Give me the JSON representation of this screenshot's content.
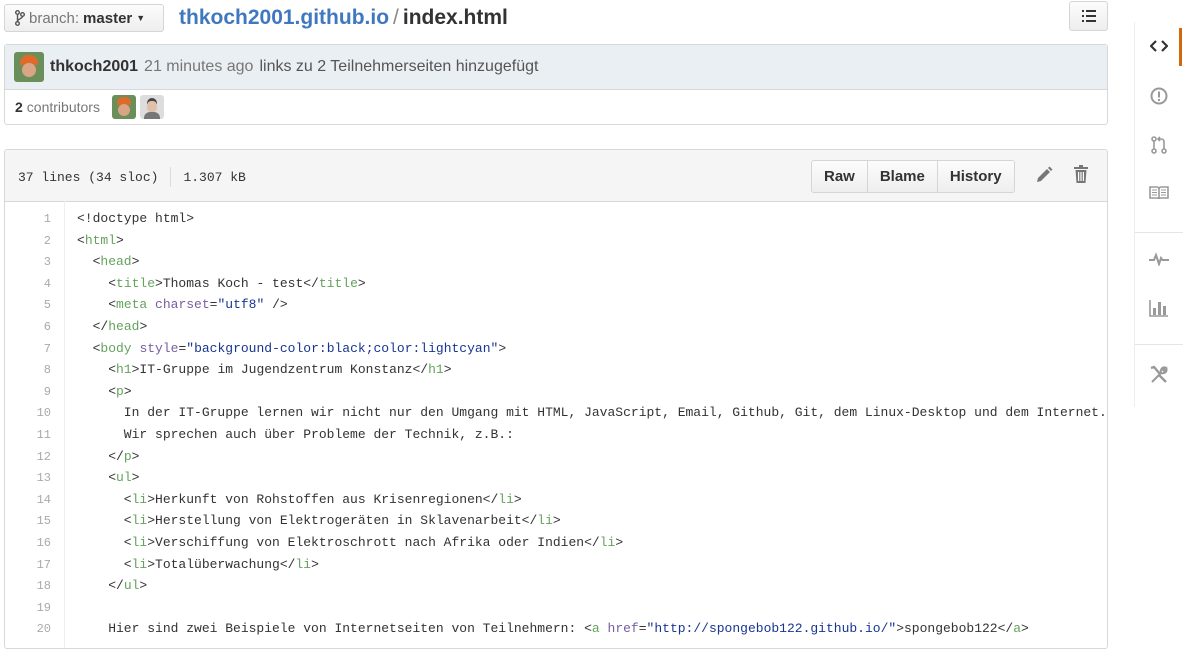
{
  "header": {
    "branch_label": "branch:",
    "branch_value": "master",
    "repo": "thkoch2001.github.io",
    "separator": "/",
    "file": "index.html"
  },
  "commit": {
    "author": "thkoch2001",
    "time": "21 minutes ago",
    "message": "links zu 2 Teilnehmerseiten hinzugefügt",
    "contributors_count": "2",
    "contributors_label": "contributors"
  },
  "file": {
    "lines_info": "37 lines (34 sloc)",
    "size": "1.307 kB",
    "buttons": [
      "Raw",
      "Blame",
      "History"
    ]
  },
  "code": [
    {
      "n": "1",
      "html": "&lt;!doctype html&gt;"
    },
    {
      "n": "2",
      "html": "&lt;<span class=\"t\">html</span>&gt;"
    },
    {
      "n": "3",
      "html": "  &lt;<span class=\"t\">head</span>&gt;"
    },
    {
      "n": "4",
      "html": "    &lt;<span class=\"t\">title</span>&gt;Thomas Koch - test&lt;/<span class=\"t\">title</span>&gt;"
    },
    {
      "n": "5",
      "html": "    &lt;<span class=\"t\">meta</span> <span class=\"a\">charset</span>=<span class=\"s\">\"utf8\"</span> /&gt;"
    },
    {
      "n": "6",
      "html": "  &lt;/<span class=\"t\">head</span>&gt;"
    },
    {
      "n": "7",
      "html": "  &lt;<span class=\"t\">body</span> <span class=\"a\">style</span>=<span class=\"s\">\"background-color:black;color:lightcyan\"</span>&gt;"
    },
    {
      "n": "8",
      "html": "    &lt;<span class=\"t\">h1</span>&gt;IT-Gruppe im Jugendzentrum Konstanz&lt;/<span class=\"t\">h1</span>&gt;"
    },
    {
      "n": "9",
      "html": "    &lt;<span class=\"t\">p</span>&gt;"
    },
    {
      "n": "10",
      "html": "      In der IT-Gruppe lernen wir nicht nur den Umgang mit HTML, JavaScript, Email, Github, Git, dem Linux-Desktop und dem Internet."
    },
    {
      "n": "11",
      "html": "      Wir sprechen auch über Probleme der Technik, z.B.:"
    },
    {
      "n": "12",
      "html": "    &lt;/<span class=\"t\">p</span>&gt;"
    },
    {
      "n": "13",
      "html": "    &lt;<span class=\"t\">ul</span>&gt;"
    },
    {
      "n": "14",
      "html": "      &lt;<span class=\"t\">li</span>&gt;Herkunft von Rohstoffen aus Krisenregionen&lt;/<span class=\"t\">li</span>&gt;"
    },
    {
      "n": "15",
      "html": "      &lt;<span class=\"t\">li</span>&gt;Herstellung von Elektrogeräten in Sklavenarbeit&lt;/<span class=\"t\">li</span>&gt;"
    },
    {
      "n": "16",
      "html": "      &lt;<span class=\"t\">li</span>&gt;Verschiffung von Elektroschrott nach Afrika oder Indien&lt;/<span class=\"t\">li</span>&gt;"
    },
    {
      "n": "17",
      "html": "      &lt;<span class=\"t\">li</span>&gt;Totalüberwachung&lt;/<span class=\"t\">li</span>&gt;"
    },
    {
      "n": "18",
      "html": "    &lt;/<span class=\"t\">ul</span>&gt;"
    },
    {
      "n": "19",
      "html": ""
    },
    {
      "n": "20",
      "html": "    Hier sind zwei Beispiele von Internetseiten von Teilnehmern: &lt;<span class=\"t\">a</span> <span class=\"a\">href</span>=<span class=\"s\">\"http://spongebob122.github.io/\"</span>&gt;spongebob122&lt;/<span class=\"t\">a</span>&gt;"
    }
  ],
  "nav": [
    "code-icon",
    "issues-icon",
    "pull-request-icon",
    "wiki-icon",
    "pulse-icon",
    "graphs-icon",
    "settings-icon"
  ],
  "colors": {
    "link": "#4078c0",
    "tag": "#63a35c",
    "attr": "#795da3",
    "string": "#183691",
    "active_nav": "#d26911"
  }
}
